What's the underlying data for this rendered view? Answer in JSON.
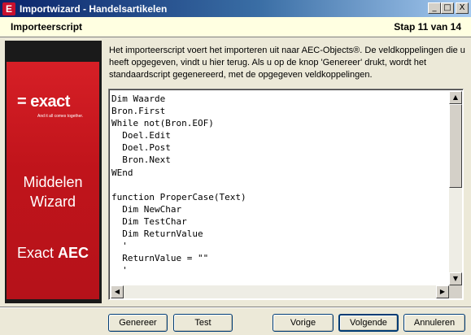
{
  "window": {
    "title": "Importwizard - Handelsartikelen",
    "icon_letter": "E",
    "controls": {
      "minimize": "_",
      "maximize": "□",
      "close": "X"
    }
  },
  "header": {
    "title": "Importeerscript",
    "step": "Stap 11 van 14"
  },
  "banner": {
    "logo": "= exact",
    "tagline": "And it all comes together.",
    "product_line1": "Middelen",
    "product_line2": "Wizard",
    "product_line3_a": "Exact ",
    "product_line3_b": "AEC"
  },
  "description": "Het importeerscript voert het importeren uit naar AEC-Objects®. De veldkoppelingen die u heeft opgegeven, vindt u hier terug. Als u op de knop 'Genereer' drukt, wordt het standaardscript gegenereerd, met de opgegeven veldkoppelingen.",
  "script": {
    "lines": [
      "Dim Waarde",
      "Bron.First",
      "While not(Bron.EOF)",
      "  Doel.Edit",
      "  Doel.Post",
      "  Bron.Next",
      "WEnd",
      "",
      "function ProperCase(Text)",
      "  Dim NewChar",
      "  Dim TestChar",
      "  Dim ReturnValue",
      "  '",
      "  ReturnValue = \"\"",
      "  '"
    ]
  },
  "scrollbar_glyphs": {
    "up": "▲",
    "down": "▼",
    "left": "◀",
    "right": "▶"
  },
  "buttons": {
    "generate": "Genereer",
    "test": "Test",
    "previous": "Vorige",
    "next": "Volgende",
    "cancel": "Annuleren"
  }
}
